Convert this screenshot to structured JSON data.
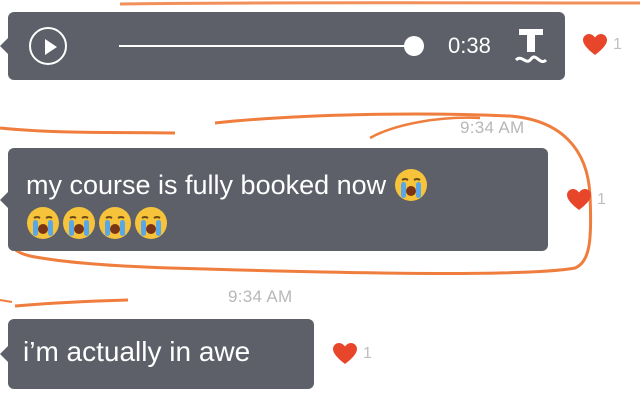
{
  "messages": [
    {
      "type": "audio",
      "duration": "0:38",
      "progress_fraction": 0.97,
      "reaction": {
        "icon": "heart-icon",
        "count": "1"
      }
    },
    {
      "type": "text",
      "timestamp": "9:34 AM",
      "text": "my course is fully booked now",
      "emoji": [
        "loudly-crying-face",
        "loudly-crying-face",
        "loudly-crying-face",
        "loudly-crying-face",
        "loudly-crying-face"
      ],
      "reaction": {
        "icon": "heart-icon",
        "count": "1"
      }
    },
    {
      "type": "text",
      "timestamp": "9:34 AM",
      "text": "i’m actually in awe",
      "reaction": {
        "icon": "heart-icon",
        "count": "1"
      }
    }
  ],
  "colors": {
    "bubble": "#5d6068",
    "heart": "#e8462a",
    "annotation": "#ef7d3d",
    "timestamp": "#b7b7b7"
  },
  "icons": [
    "play-icon",
    "transcribe-icon",
    "heart-icon",
    "loudly-crying-face-emoji"
  ]
}
